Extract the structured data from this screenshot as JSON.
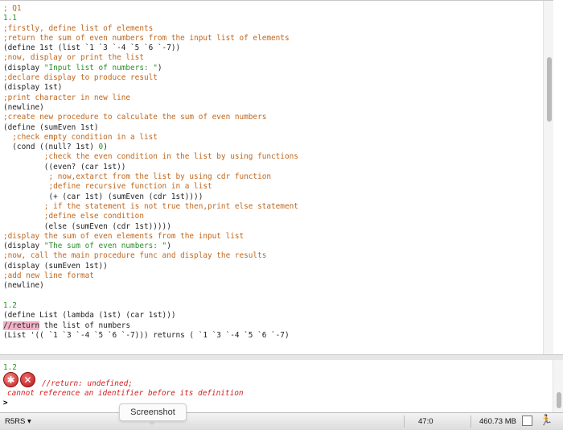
{
  "editor": {
    "lines": [
      {
        "parts": [
          {
            "t": "; Q1",
            "k": "c"
          }
        ]
      },
      {
        "parts": [
          {
            "t": "1.1",
            "k": "s"
          }
        ]
      },
      {
        "parts": [
          {
            "t": ";firstly, define list of elements",
            "k": "c"
          }
        ]
      },
      {
        "parts": [
          {
            "t": ";return the sum of even numbers from the input list of elements",
            "k": "c"
          }
        ]
      },
      {
        "parts": [
          {
            "t": "(define 1st (list `1 `3 `-4 `5 `6 `-7))",
            "k": ""
          }
        ]
      },
      {
        "parts": [
          {
            "t": ";now, display or print the list",
            "k": "c"
          }
        ]
      },
      {
        "parts": [
          {
            "t": "(display ",
            "k": ""
          },
          {
            "t": "\"Input list of numbers: \"",
            "k": "s"
          },
          {
            "t": ")",
            "k": ""
          }
        ]
      },
      {
        "parts": [
          {
            "t": ";declare display to produce result",
            "k": "c"
          }
        ]
      },
      {
        "parts": [
          {
            "t": "(display 1st)",
            "k": ""
          }
        ]
      },
      {
        "parts": [
          {
            "t": ";print character in new line",
            "k": "c"
          }
        ]
      },
      {
        "parts": [
          {
            "t": "(newline)",
            "k": ""
          }
        ]
      },
      {
        "parts": [
          {
            "t": ";create new procedure to calculate the sum of even numbers",
            "k": "c"
          }
        ]
      },
      {
        "parts": [
          {
            "t": "(define (sumEven 1st)",
            "k": ""
          }
        ]
      },
      {
        "parts": [
          {
            "t": "  ;check empty condition in a list",
            "k": "c"
          }
        ]
      },
      {
        "parts": [
          {
            "t": "  (cond ((null? 1st) ",
            "k": ""
          },
          {
            "t": "0",
            "k": "s"
          },
          {
            "t": ")",
            "k": ""
          }
        ]
      },
      {
        "parts": [
          {
            "t": "         ;check the even condition in the list by using functions",
            "k": "c"
          }
        ]
      },
      {
        "parts": [
          {
            "t": "         ((even? (car 1st))",
            "k": ""
          }
        ]
      },
      {
        "parts": [
          {
            "t": "          ; now,extarct from the list by using cdr function",
            "k": "c"
          }
        ]
      },
      {
        "parts": [
          {
            "t": "          ;define recursive function in a list",
            "k": "c"
          }
        ]
      },
      {
        "parts": [
          {
            "t": "          (+ (car 1st) (sumEven (cdr 1st))))",
            "k": ""
          }
        ]
      },
      {
        "parts": [
          {
            "t": "         ; if the statement is not true then,print else statement",
            "k": "c"
          }
        ]
      },
      {
        "parts": [
          {
            "t": "         ;define else condition",
            "k": "c"
          }
        ]
      },
      {
        "parts": [
          {
            "t": "         (else (sumEven (cdr 1st)))))",
            "k": ""
          }
        ]
      },
      {
        "parts": [
          {
            "t": ";display the sum of even elements from the input list",
            "k": "c"
          }
        ]
      },
      {
        "parts": [
          {
            "t": "(display ",
            "k": ""
          },
          {
            "t": "\"The sum of even numbers: \"",
            "k": "s"
          },
          {
            "t": ")",
            "k": ""
          }
        ]
      },
      {
        "parts": [
          {
            "t": ";now, call the main procedure func and display the results",
            "k": "c"
          }
        ]
      },
      {
        "parts": [
          {
            "t": "(display (sumEven 1st))",
            "k": ""
          }
        ]
      },
      {
        "parts": [
          {
            "t": ";add new line format",
            "k": "c"
          }
        ]
      },
      {
        "parts": [
          {
            "t": "(newline)",
            "k": ""
          }
        ]
      },
      {
        "parts": [
          {
            "t": "",
            "k": ""
          }
        ]
      },
      {
        "parts": [
          {
            "t": "1.2",
            "k": "s"
          }
        ]
      },
      {
        "parts": [
          {
            "t": "(define List (lambda (1st) (car 1st)))",
            "k": ""
          }
        ]
      },
      {
        "parts": [
          {
            "t": "//return",
            "k": "hl"
          },
          {
            "t": " the list of numbers",
            "k": ""
          }
        ]
      },
      {
        "parts": [
          {
            "t": "(List '(( `1 `3 `-4 `5 `6 `-7))) returns ( `1 `3 `-4 `5 `6 `-7)",
            "k": ""
          }
        ]
      }
    ]
  },
  "repl": {
    "input_echo": "1.2",
    "error_line1": "//return: undefined;",
    "error_line2": "cannot reference an identifier before its definition",
    "prompt": ">"
  },
  "statusbar": {
    "language": "R5RS ▾",
    "position": "47:0",
    "memory": "460.73 MB"
  },
  "tooltip": {
    "label": "Screenshot"
  },
  "icons": {
    "bug": "bug-icon",
    "error": "error-x-icon",
    "runner": "running-figure-icon"
  }
}
